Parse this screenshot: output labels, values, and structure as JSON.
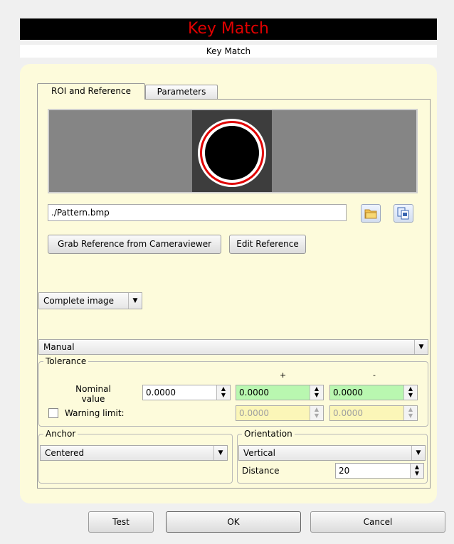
{
  "header": {
    "title": "Key Match",
    "subtitle": "Key Match"
  },
  "tabs": [
    "ROI and Reference",
    "Parameters"
  ],
  "reference": {
    "path": "./Pattern.bmp",
    "grab_button": "Grab Reference from Cameraviewer",
    "edit_button": "Edit Reference"
  },
  "roi_select": "Complete image",
  "mode_select": "Manual",
  "tolerance": {
    "legend": "Tolerance",
    "plus_header": "+",
    "minus_header": "-",
    "nominal_label": "Nominal value",
    "nominal_value": "0.0000",
    "plus_value": "0.0000",
    "minus_value": "0.0000",
    "warning_label": "Warning limit:",
    "warning_checked": false,
    "warning_plus": "0.0000",
    "warning_minus": "0.0000"
  },
  "anchor": {
    "legend": "Anchor",
    "value": "Centered"
  },
  "orientation": {
    "legend": "Orientation",
    "value": "Vertical",
    "distance_label": "Distance",
    "distance_value": "20"
  },
  "buttons": {
    "test": "Test",
    "ok": "OK",
    "cancel": "Cancel"
  },
  "colors": {
    "title_bg": "#000000",
    "title_text": "#e00000",
    "panel_bg": "#fdfbdb",
    "green_field": "#b9f7b0",
    "yellow_field": "#fbf6b8"
  }
}
